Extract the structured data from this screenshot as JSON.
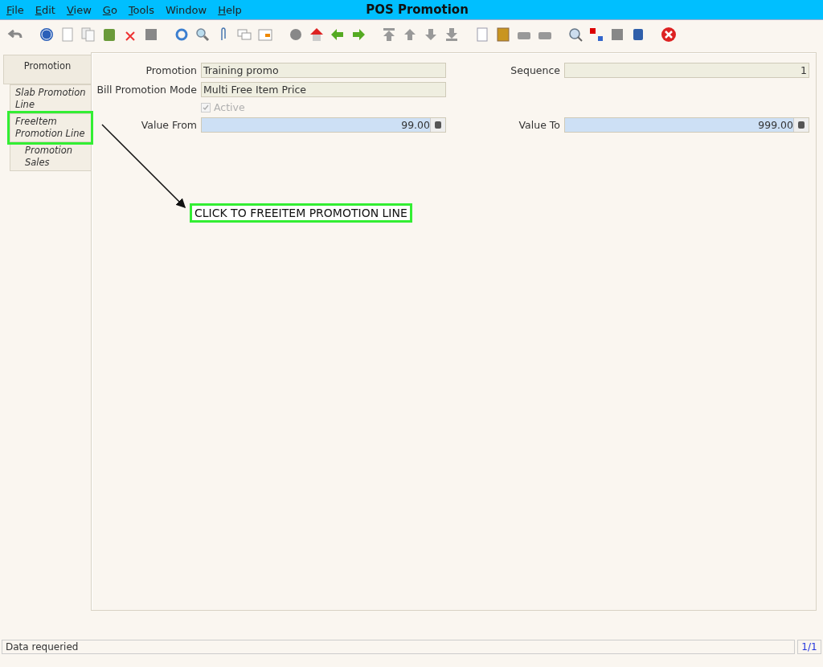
{
  "menu": [
    {
      "label": "File",
      "mnemonic": true
    },
    {
      "label": "Edit",
      "mnemonic": true
    },
    {
      "label": "View",
      "mnemonic": true
    },
    {
      "label": "Go",
      "mnemonic": true
    },
    {
      "label": "Tools",
      "mnemonic": true
    },
    {
      "label": "Window",
      "mnemonic": false
    },
    {
      "label": "Help",
      "mnemonic": true
    }
  ],
  "window": {
    "title": "POS Promotion"
  },
  "tabs": [
    {
      "label": "Promotion",
      "selected": true,
      "highlighted": false,
      "children": [
        {
          "label": "Slab Promotion Line",
          "selected": false,
          "highlighted": false
        },
        {
          "label": "FreeItem Promotion Line",
          "selected": false,
          "highlighted": true,
          "children": [
            {
              "label": "Promotion Sales",
              "selected": false,
              "highlighted": false
            }
          ]
        }
      ]
    }
  ],
  "form": {
    "rows": [
      [
        {
          "kind": "text",
          "label": "Promotion",
          "value": "Training promo"
        },
        {
          "kind": "number",
          "label": "Sequence",
          "value": "1"
        }
      ],
      [
        {
          "kind": "text",
          "label": "Bill Promotion Mode",
          "value": "Multi Free Item Price"
        }
      ],
      [
        {
          "kind": "checkbox",
          "label": "Active",
          "checked": true,
          "disabled": true
        }
      ],
      [
        {
          "kind": "amount",
          "label": "Value From",
          "value": "99.00"
        },
        {
          "kind": "amount",
          "label": "Value To",
          "value": "999.00"
        }
      ]
    ]
  },
  "callout": {
    "text": "CLICK TO FREEITEM PROMOTION LINE"
  },
  "status_bar": {
    "message": "Data requeried",
    "record": "1/1"
  }
}
